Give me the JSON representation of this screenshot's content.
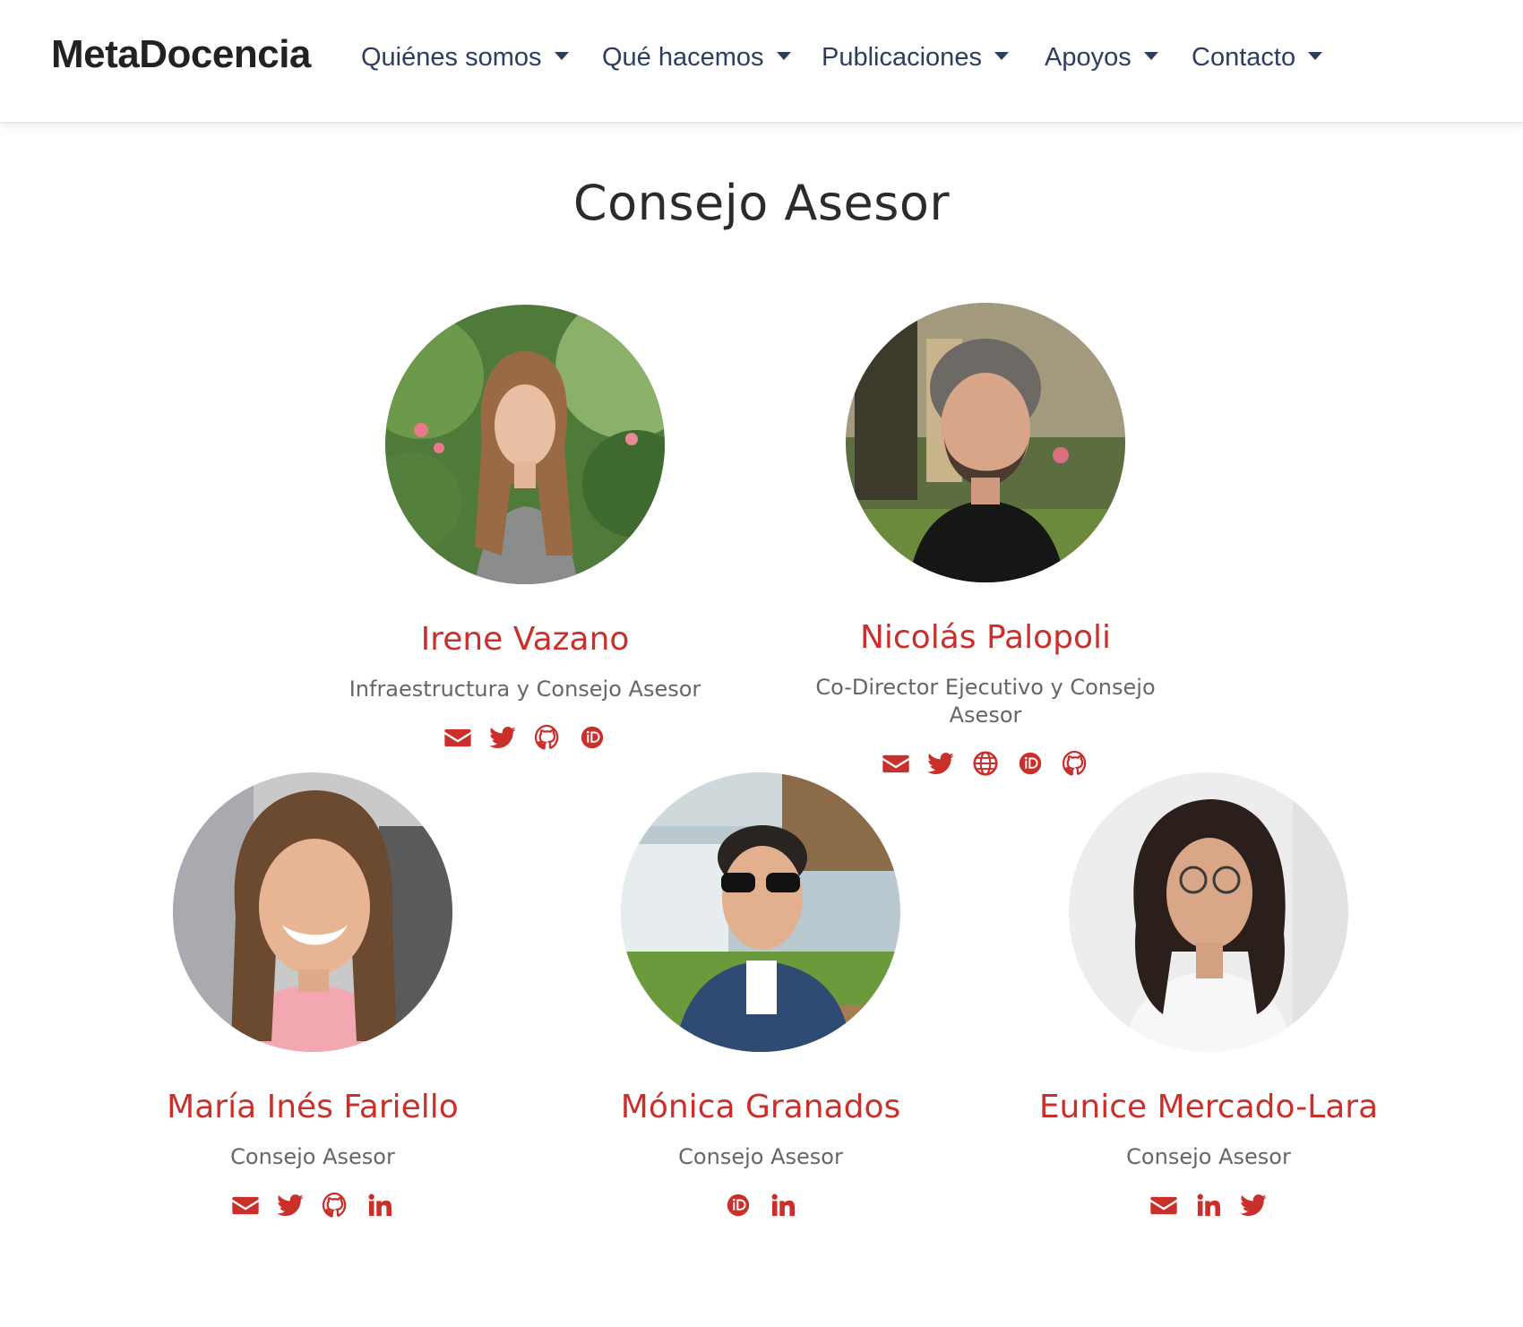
{
  "nav": {
    "brand": "MetaDocencia",
    "items": [
      {
        "label": "Quiénes somos"
      },
      {
        "label": "Qué hacemos"
      },
      {
        "label": "Publicaciones"
      },
      {
        "label": "Apoyos"
      },
      {
        "label": "Contacto"
      }
    ]
  },
  "page": {
    "title": "Consejo Asesor"
  },
  "colors": {
    "accent": "#c9302c",
    "nav_text": "#2c3e60"
  },
  "people": [
    {
      "name": "Irene Vazano",
      "role": "Infraestructura y Consejo Asesor",
      "links": [
        "envelope-icon",
        "twitter-icon",
        "github-icon",
        "orcid-icon"
      ]
    },
    {
      "name": "Nicolás Palopoli",
      "role": "Co-Director Ejecutivo y Consejo Asesor",
      "links": [
        "envelope-icon",
        "twitter-icon",
        "globe-icon",
        "orcid-icon",
        "github-icon"
      ]
    },
    {
      "name": "María Inés Fariello",
      "role": "Consejo Asesor",
      "links": [
        "envelope-icon",
        "twitter-icon",
        "github-icon",
        "linkedin-icon"
      ]
    },
    {
      "name": "Mónica Granados",
      "role": "Consejo Asesor",
      "links": [
        "orcid-icon",
        "linkedin-icon"
      ]
    },
    {
      "name": "Eunice Mercado-Lara",
      "role": "Consejo Asesor",
      "links": [
        "envelope-icon",
        "linkedin-icon",
        "twitter-icon"
      ]
    }
  ]
}
